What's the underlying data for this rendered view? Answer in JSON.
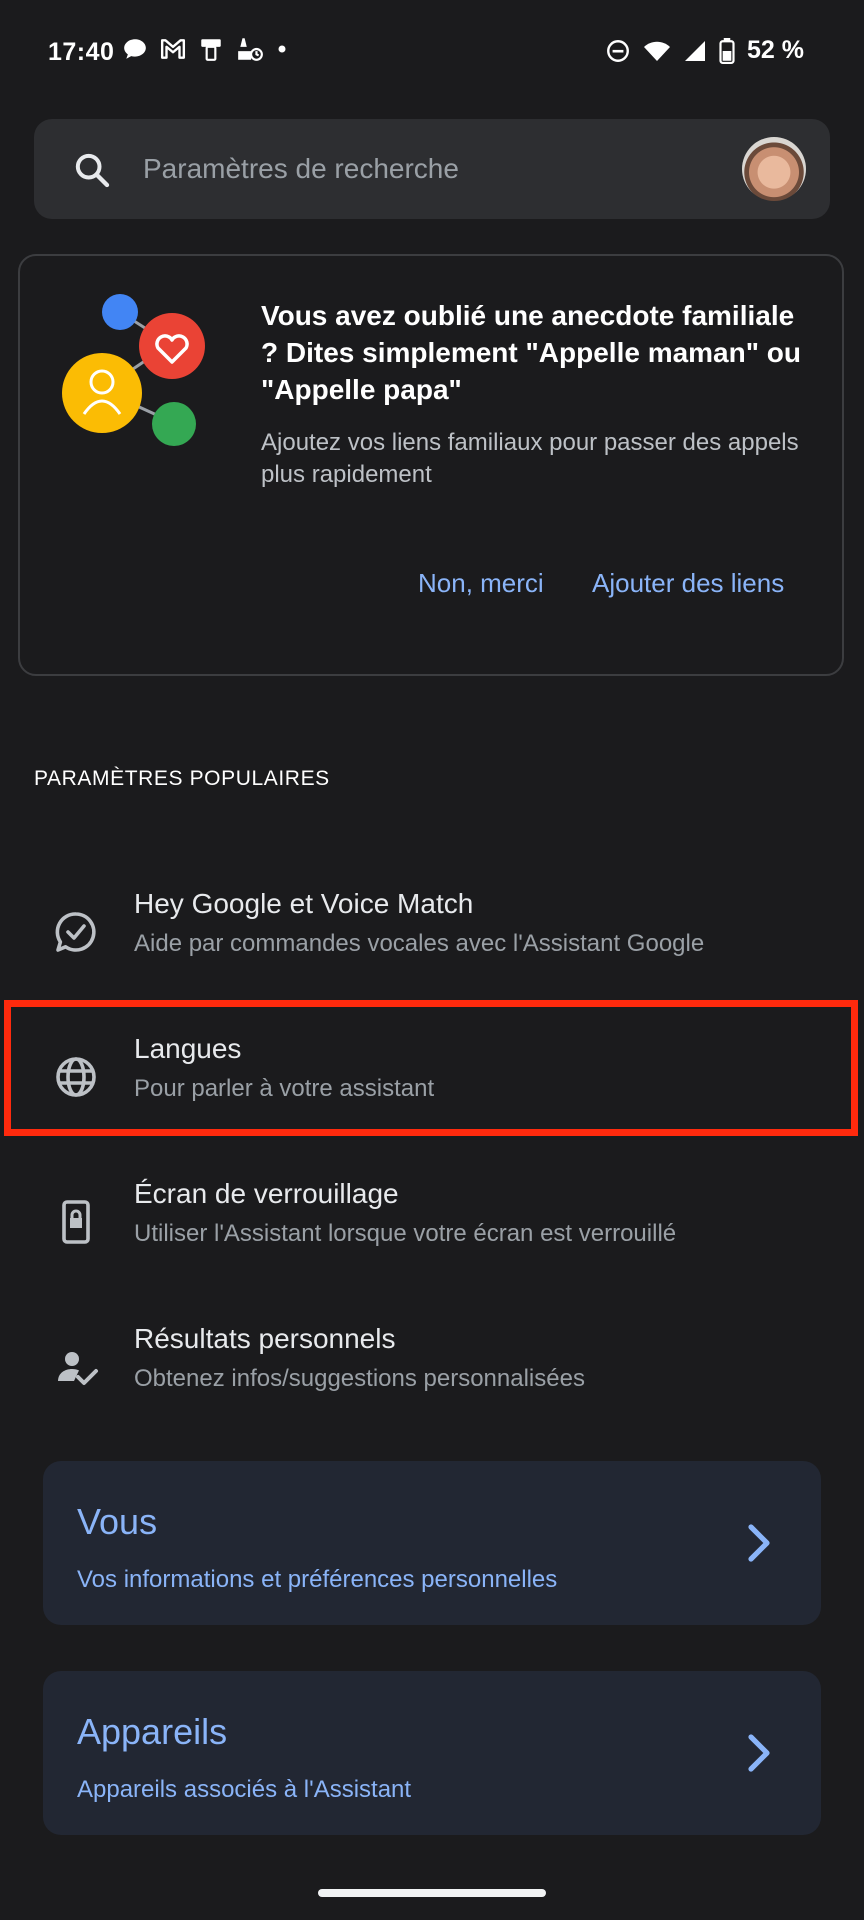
{
  "status_bar": {
    "time": "17:40",
    "battery": "52 %",
    "left_icons": [
      "chat-bubble-icon",
      "gmail-icon",
      "device-icon",
      "cleaning-icon",
      "dot-icon"
    ],
    "right_icons": [
      "do-not-disturb-icon",
      "wifi-icon",
      "signal-icon",
      "battery-icon"
    ]
  },
  "search": {
    "placeholder": "Paramètres de recherche"
  },
  "promo": {
    "title": "Vous avez oublié une anecdote familiale ? Dites simplement \"Appelle maman\" ou \"Appelle papa\"",
    "body": "Ajoutez vos liens familiaux pour passer des appels plus rapidement",
    "dismiss_label": "Non, merci",
    "add_label": "Ajouter des liens"
  },
  "popular": {
    "header": "PARAMÈTRES POPULAIRES",
    "items": [
      {
        "title": "Hey Google et Voice Match",
        "subtitle": "Aide par commandes vocales avec l'Assistant Google",
        "icon": "voice-match-icon"
      },
      {
        "title": "Langues",
        "subtitle": "Pour parler à votre assistant",
        "icon": "globe-icon"
      },
      {
        "title": "Écran de verrouillage",
        "subtitle": "Utiliser l'Assistant lorsque votre écran est verrouillé",
        "icon": "lock-screen-icon"
      },
      {
        "title": "Résultats personnels",
        "subtitle": "Obtenez infos/suggestions personnalisées",
        "icon": "personal-results-icon"
      }
    ]
  },
  "cards": [
    {
      "title": "Vous",
      "subtitle": "Vos informations et préférences personnelles"
    },
    {
      "title": "Appareils",
      "subtitle": "Appareils associés à l'Assistant"
    }
  ],
  "colors": {
    "background": "#1b1b1d",
    "accent": "#8ab4f8",
    "highlight": "#ff2a0d",
    "card": "#222733"
  }
}
